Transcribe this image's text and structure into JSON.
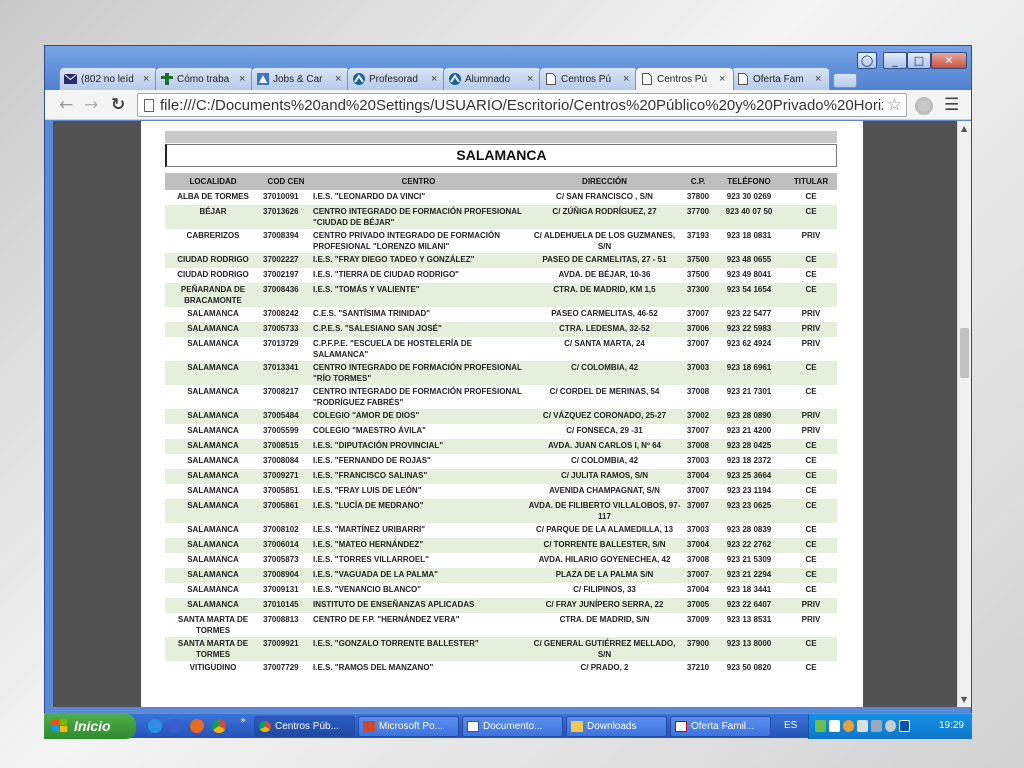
{
  "browser": {
    "tabs": [
      {
        "label": "(802 no leíd",
        "icon": "mail-icon",
        "active": false
      },
      {
        "label": "Cómo traba",
        "icon": "worker-icon",
        "active": false
      },
      {
        "label": "Jobs & Car",
        "icon": "jobs-icon",
        "active": false
      },
      {
        "label": "Profesorad",
        "icon": "profesorado-icon",
        "active": false
      },
      {
        "label": "Alumnado",
        "icon": "alumnado-icon",
        "active": false
      },
      {
        "label": "Centros Pú",
        "icon": "document-icon",
        "active": false
      },
      {
        "label": "Centros Pú",
        "icon": "document-icon",
        "active": true
      },
      {
        "label": "Oferta Fam",
        "icon": "document-icon",
        "active": false
      }
    ],
    "close_glyph": "×",
    "url": "file:///C:/Documents%20and%20Settings/USUARIO/Escritorio/Centros%20Público%20y%20Privado%20Horizontal.pdf",
    "window_controls": {
      "minimize": "_",
      "maximize": "□",
      "close": "✕"
    }
  },
  "document": {
    "city": "SALAMANCA",
    "headers": {
      "localidad": "LOCALIDAD",
      "cod_cen": "COD CEN",
      "centro": "CENTRO",
      "direccion": "DIRECCIÓN",
      "cp": "C.P.",
      "telefono": "TELÉFONO",
      "titular": "TITULAR"
    },
    "rows": [
      [
        "ALBA DE TORMES",
        "37010091",
        "I.E.S. \"LEONARDO DA VINCI\"",
        "C/ SAN FRANCISCO , S/N",
        "37800",
        "923 30 0269",
        "CE"
      ],
      [
        "BÉJAR",
        "37013626",
        "CENTRO INTEGRADO DE FORMACIÓN PROFESIONAL \"CIUDAD DE BÉJAR\"",
        "C/ ZÚÑIGA RODRÍGUEZ, 27",
        "37700",
        "923 40 07 50",
        "CE"
      ],
      [
        "CABRERIZOS",
        "37008394",
        "CENTRO PRIVADO INTEGRADO DE FORMACIÓN PROFESIONAL \"LORENZO MILANI\"",
        "C/ ALDEHUELA DE LOS GUZMANES, S/N",
        "37193",
        "923 18 0831",
        "PRIV"
      ],
      [
        "CIUDAD RODRIGO",
        "37002227",
        "I.E.S. \"FRAY DIEGO TADEO Y GONZÁLEZ\"",
        "PASEO DE CARMELITAS, 27 - 51",
        "37500",
        "923 48 0655",
        "CE"
      ],
      [
        "CIUDAD RODRIGO",
        "37002197",
        "I.E.S. \"TIERRA DE CIUDAD RODRIGO\"",
        "AVDA. DE BÉJAR, 10-36",
        "37500",
        "923 49 8041",
        "CE"
      ],
      [
        "PEÑARANDA DE BRACAMONTE",
        "37008436",
        "I.E.S. \"TOMÁS Y VALIENTE\"",
        "CTRA. DE MADRID, KM 1,5",
        "37300",
        "923 54 1654",
        "CE"
      ],
      [
        "SALAMANCA",
        "37008242",
        "C.E.S. \"SANTÍSIMA TRINIDAD\"",
        "PASEO CARMELITAS, 46-52",
        "37007",
        "923 22 5477",
        "PRIV"
      ],
      [
        "SALAMANCA",
        "37005733",
        "C.P.E.S. \"SALESIANO SAN JOSÉ\"",
        "CTRA. LEDESMA, 32-52",
        "37006",
        "923 22 5983",
        "PRIV"
      ],
      [
        "SALAMANCA",
        "37013729",
        "C.P.F.P.E. \"ESCUELA DE HOSTELERÍA DE SALAMANCA\"",
        "C/ SANTA MARTA, 24",
        "37007",
        "923 62 4924",
        "PRIV"
      ],
      [
        "SALAMANCA",
        "37013341",
        "CENTRO INTEGRADO DE FORMACIÓN PROFESIONAL \"RÍO TORMES\"",
        "C/ COLOMBIA, 42",
        "37003",
        "923 18 6961",
        "CE"
      ],
      [
        "SALAMANCA",
        "37008217",
        "CENTRO INTEGRADO DE FORMACIÓN PROFESIONAL \"RODRÍGUEZ FABRÉS\"",
        "C/ CORDEL DE MERINAS, 54",
        "37008",
        "923 21 7301",
        "CE"
      ],
      [
        "SALAMANCA",
        "37005484",
        "COLEGIO \"AMOR DE DIOS\"",
        "C/ VÁZQUEZ CORONADO, 25-27",
        "37002",
        "923 28 0890",
        "PRIV"
      ],
      [
        "SALAMANCA",
        "37005599",
        "COLEGIO \"MAESTRO ÁVILA\"",
        "C/ FONSECA, 29 -31",
        "37007",
        "923 21 4200",
        "PRIV"
      ],
      [
        "SALAMANCA",
        "37008515",
        "I.E.S. \"DIPUTACIÓN PROVINCIAL\"",
        "AVDA. JUAN CARLOS I, Nº 64",
        "37008",
        "923 28 0425",
        "CE"
      ],
      [
        "SALAMANCA",
        "37008084",
        "I.E.S. \"FERNANDO DE ROJAS\"",
        "C/ COLOMBIA, 42",
        "37003",
        "923 18 2372",
        "CE"
      ],
      [
        "SALAMANCA",
        "37009271",
        "I.E.S. \"FRANCISCO SALINAS\"",
        "C/ JULITA RAMOS, S/N",
        "37004",
        "923 25 3664",
        "CE"
      ],
      [
        "SALAMANCA",
        "37005851",
        "I.E.S. \"FRAY LUIS DE LEÓN\"",
        "AVENIDA CHAMPAGNAT, S/N",
        "37007",
        "923 23 1194",
        "CE"
      ],
      [
        "SALAMANCA",
        "37005861",
        "I.E.S. \"LUCÍA DE MEDRANO\"",
        "AVDA. DE FILIBERTO VILLALOBOS, 97-117",
        "37007",
        "923 23 0625",
        "CE"
      ],
      [
        "SALAMANCA",
        "37008102",
        "I.E.S. \"MARTÍNEZ URIBARRI\"",
        "C/ PARQUE DE LA ALAMEDILLA, 13",
        "37003",
        "923 28 0839",
        "CE"
      ],
      [
        "SALAMANCA",
        "37006014",
        "I.E.S. \"MATEO HERNÁNDEZ\"",
        "C/ TORRENTE BALLESTER, S/N",
        "37004",
        "923 22 2762",
        "CE"
      ],
      [
        "SALAMANCA",
        "37005873",
        "I.E.S. \"TORRES VILLARROEL\"",
        "AVDA. HILARIO GOYENECHEA, 42",
        "37008",
        "923 21 5309",
        "CE"
      ],
      [
        "SALAMANCA",
        "37008904",
        "I.E.S. \"VAGUADA DE LA PALMA\"",
        "PLAZA DE LA PALMA S/N",
        "37007",
        "923 21 2294",
        "CE"
      ],
      [
        "SALAMANCA",
        "37009131",
        "I.E.S. \"VENANCIO BLANCO\"",
        "C/ FILIPINOS, 33",
        "37004",
        "923 18 3441",
        "CE"
      ],
      [
        "SALAMANCA",
        "37010145",
        "INSTITUTO DE ENSEÑANZAS APLICADAS",
        "C/ FRAY JUNÍPERO SERRA, 22",
        "37005",
        "923 22 6407",
        "PRIV"
      ],
      [
        "SANTA MARTA DE TORMES",
        "37008813",
        "CENTRO DE F.P. \"HERNÁNDEZ VERA\"",
        "CTRA. DE MADRID, S/N",
        "37009",
        "923 13 8531",
        "PRIV"
      ],
      [
        "SANTA MARTA DE TORMES",
        "37009921",
        "I.E.S. \"GONZALO TORRENTE BALLESTER\"",
        "C/ GENERAL GUTIÉRREZ MELLADO, S/N",
        "37900",
        "923 13 8000",
        "CE"
      ],
      [
        "VITIGUDINO",
        "37007729",
        "I.E.S. \"RAMOS DEL MANZANO\"",
        "C/ PRADO, 2",
        "37210",
        "923 50 0820",
        "CE"
      ]
    ]
  },
  "taskbar": {
    "start_label": "Inicio",
    "more_glyph": "»",
    "tasks": [
      {
        "label": "Centros Púb...",
        "icon": "chrome-icon",
        "active": true
      },
      {
        "label": "Microsoft Po...",
        "icon": "powerpoint-icon",
        "active": false
      },
      {
        "label": "Documento...",
        "icon": "word-icon",
        "active": false
      },
      {
        "label": "Downloads",
        "icon": "folder-icon",
        "active": false
      },
      {
        "label": "Oferta Famil...",
        "icon": "pdf-icon",
        "active": false
      }
    ],
    "language": "ES",
    "clock": "19:29"
  },
  "colors": {
    "row_alt": "#e6efdb",
    "header_bg": "#bfbfbf",
    "taskbar_blue": "#2453b8",
    "start_green": "#3a9a36"
  }
}
